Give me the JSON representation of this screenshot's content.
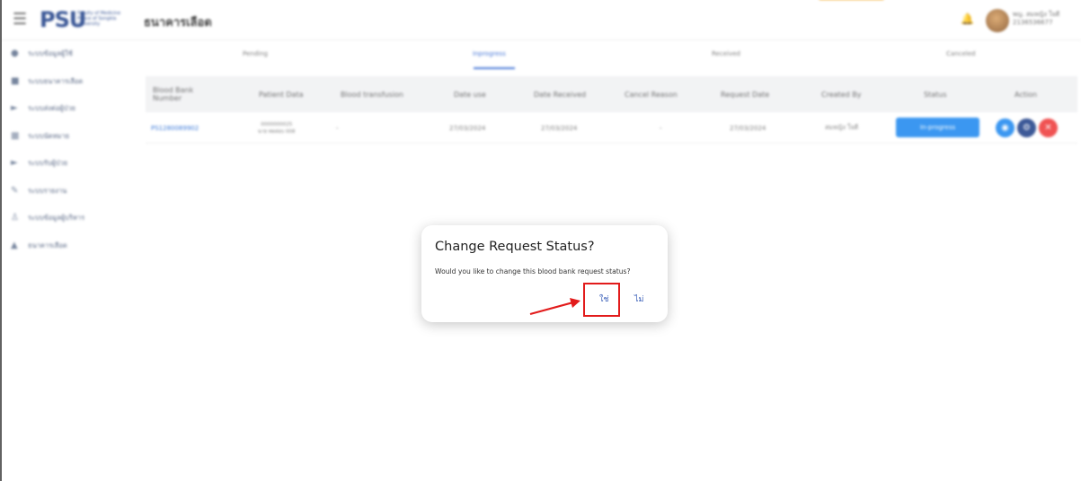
{
  "header": {
    "menu_icon": "hamburger-icon",
    "logo_mark": "PSU",
    "logo_subtitle": "Faculty of Medicine Prince of Songkla University",
    "app_title": "ธนาคารเลือด",
    "bell_icon": "bell-icon",
    "user_name": "พญ. สมหญิง ใจดี",
    "user_id": "2136536677"
  },
  "sidebar": {
    "items": [
      {
        "icon": "users-icon",
        "label": "ระบบข้อมูลผู้ใช้"
      },
      {
        "icon": "droplet-icon",
        "label": "ระบบธนาคารเลือด"
      },
      {
        "icon": "user-arrow-icon",
        "label": "ระบบส่งต่อผู้ป่วย"
      },
      {
        "icon": "grid-icon",
        "label": "ระบบนัดหมาย"
      },
      {
        "icon": "user-arrow-icon",
        "label": "ระบบรับผู้ป่วย"
      },
      {
        "icon": "pencil-icon",
        "label": "ระบบรายงาน"
      },
      {
        "icon": "person-icon",
        "label": "ระบบข้อมูลผู้บริหาร"
      },
      {
        "icon": "bottle-icon",
        "label": "ธนาคารเลือด"
      }
    ]
  },
  "tabs": [
    "Pending",
    "Inprogress",
    "Received",
    "Canceled"
  ],
  "table": {
    "columns": [
      "Blood Bank Number",
      "Patient Data",
      "Blood transfusion",
      "Date use",
      "Date Received",
      "Cancel Reason",
      "Request Date",
      "Created By",
      "Status",
      "Action"
    ],
    "rows": [
      {
        "blood_bank_number": "PS1280089902",
        "patient_id": "0000000025",
        "patient_name": "นาย ทดสอบ 008",
        "blood_transfusion": "-",
        "date_use": "27/03/2024",
        "date_received": "27/03/2024",
        "cancel_reason": "-",
        "request_date": "27/03/2024",
        "created_by": "สมหญิง ใจดี",
        "status": "In-progress"
      }
    ]
  },
  "dialog": {
    "title": "Change Request Status?",
    "message": "Would you like to change this blood bank request status?",
    "confirm_label": "ใช่",
    "cancel_label": "ไม่"
  },
  "colors": {
    "accent": "#2b8ff0",
    "highlight": "#e21b1b",
    "action_view": "#2b8ff0",
    "action_edit": "#2c4b8f",
    "action_delete": "#ef4444"
  }
}
